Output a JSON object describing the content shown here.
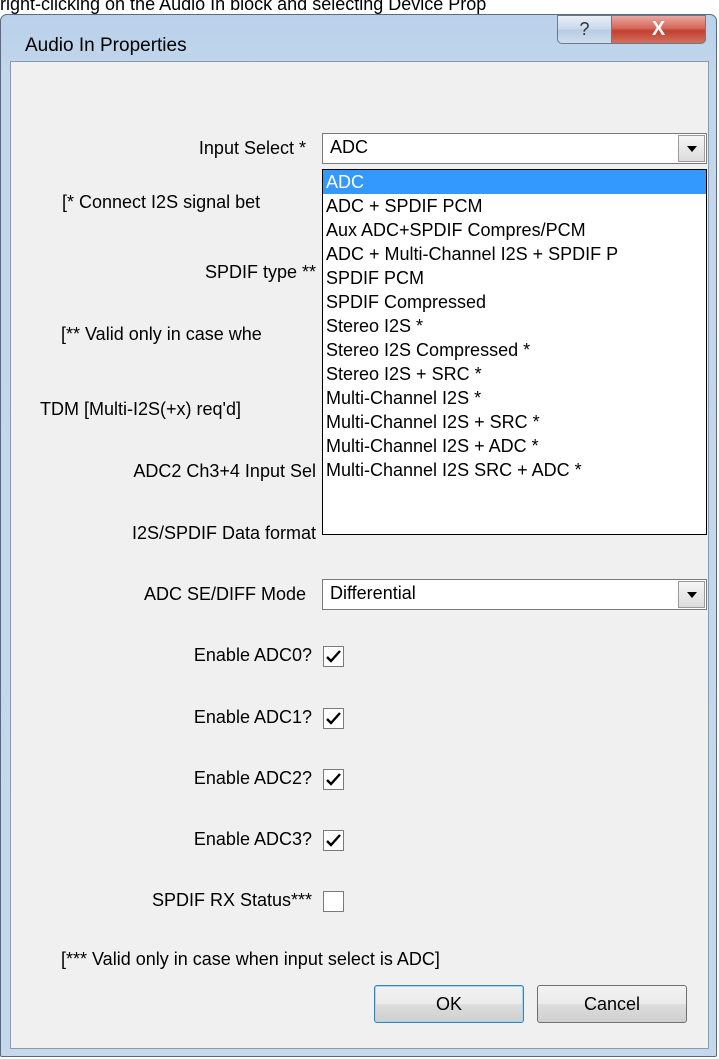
{
  "caption_text": "right-clicking on the Audio In block and selecting Device Prop",
  "window": {
    "title": "Audio In Properties",
    "help_glyph": "?",
    "close_glyph": "X"
  },
  "colors": {
    "frame": "#b9d1ea",
    "client_bg": "#f0f0f0",
    "selection": "#3399ff",
    "close_button": "#c7493a"
  },
  "form": {
    "input_select": {
      "label": "Input Select *",
      "value": "ADC",
      "options": [
        "ADC",
        "ADC + SPDIF PCM",
        "Aux ADC+SPDIF Compres/PCM",
        "ADC + Multi-Channel I2S + SPDIF P",
        "SPDIF PCM",
        "SPDIF Compressed",
        "Stereo I2S *",
        "Stereo I2S Compressed *",
        "Stereo I2S + SRC *",
        "Multi-Channel I2S *",
        "Multi-Channel I2S + SRC *",
        "Multi-Channel I2S + ADC *",
        "Multi-Channel I2S SRC + ADC *"
      ],
      "selected_index": 0
    },
    "note_connect": "[* Connect I2S signal bet",
    "spdif_type_label": "SPDIF type **",
    "note_valid": "[** Valid only in case whe",
    "tdm_label": "TDM [Multi-I2S(+x) req'd]",
    "adc2_label": "ADC2 Ch3+4 Input Sel",
    "data_format_label": "I2S/SPDIF Data format",
    "adc_mode": {
      "label": "ADC SE/DIFF Mode",
      "value": "Differential"
    },
    "checkboxes": [
      {
        "label": "Enable ADC0?",
        "checked": true
      },
      {
        "label": "Enable ADC1?",
        "checked": true
      },
      {
        "label": "Enable ADC2?",
        "checked": true
      },
      {
        "label": "Enable ADC3?",
        "checked": true
      },
      {
        "label": "SPDIF RX Status***",
        "checked": false
      }
    ],
    "footnote": "[*** Valid only in case when input select is ADC]"
  },
  "buttons": {
    "ok": "OK",
    "cancel": "Cancel"
  }
}
